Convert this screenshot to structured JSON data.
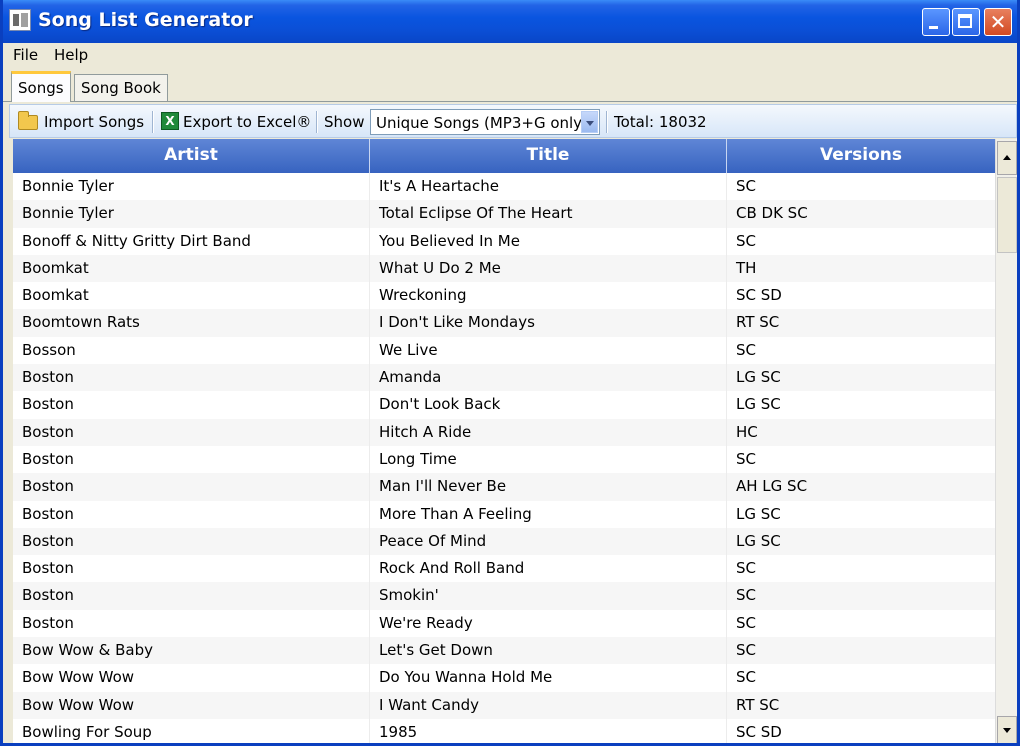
{
  "window": {
    "title": "Song List Generator",
    "close_glyph": "✕"
  },
  "menu": {
    "file": "File",
    "help": "Help"
  },
  "tabs": [
    {
      "label": "Songs",
      "active": true
    },
    {
      "label": "Song Book",
      "active": false
    }
  ],
  "toolbar": {
    "import_label": "Import Songs",
    "export_label": "Export to Excel®",
    "show_label": "Show",
    "filter_value": "Unique Songs (MP3+G only)",
    "total_label": "Total: 18032"
  },
  "table": {
    "columns": [
      "Artist",
      "Title",
      "Versions"
    ],
    "rows": [
      [
        "Bonnie Tyler",
        "It's A Heartache",
        "SC"
      ],
      [
        "Bonnie Tyler",
        "Total Eclipse Of The Heart",
        "CB DK SC"
      ],
      [
        "Bonoff & Nitty Gritty Dirt Band",
        "You Believed In Me",
        "SC"
      ],
      [
        "Boomkat",
        "What U Do 2 Me",
        "TH"
      ],
      [
        "Boomkat",
        "Wreckoning",
        "SC SD"
      ],
      [
        "Boomtown Rats",
        "I Don't Like Mondays",
        "RT SC"
      ],
      [
        "Bosson",
        "We Live",
        "SC"
      ],
      [
        "Boston",
        "Amanda",
        "LG SC"
      ],
      [
        "Boston",
        "Don't Look Back",
        "LG SC"
      ],
      [
        "Boston",
        "Hitch A Ride",
        "HC"
      ],
      [
        "Boston",
        "Long Time",
        "SC"
      ],
      [
        "Boston",
        "Man I'll Never Be",
        "AH LG SC"
      ],
      [
        "Boston",
        "More Than A Feeling",
        "LG SC"
      ],
      [
        "Boston",
        "Peace Of Mind",
        "LG SC"
      ],
      [
        "Boston",
        "Rock And Roll Band",
        "SC"
      ],
      [
        "Boston",
        "Smokin'",
        "SC"
      ],
      [
        "Boston",
        "We're Ready",
        "SC"
      ],
      [
        "Bow Wow & Baby",
        "Let's Get Down",
        "SC"
      ],
      [
        "Bow Wow Wow",
        "Do You Wanna Hold Me",
        "SC"
      ],
      [
        "Bow Wow Wow",
        "I Want Candy",
        "RT SC"
      ],
      [
        "Bowling For Soup",
        "1985",
        "SC SD"
      ]
    ]
  },
  "icons": {
    "app": "song-list-app-icon",
    "import": "folder-icon",
    "export": "excel-icon"
  }
}
